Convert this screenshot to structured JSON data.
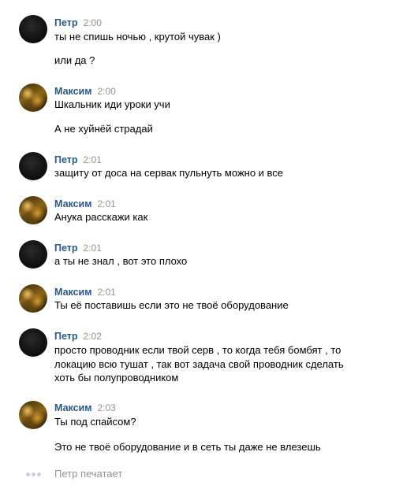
{
  "typing_indicator": "Петр печатает",
  "messages": [
    {
      "author": "Петр",
      "time": "2:00",
      "lines": [
        "ты не спишь ночью , крутой чувак )",
        "или да ?"
      ]
    },
    {
      "author": "Максим",
      "time": "2:00",
      "lines": [
        "Шкальник иди уроки учи",
        "А не хуйнёй страдай"
      ]
    },
    {
      "author": "Петр",
      "time": "2:01",
      "lines": [
        "защиту от доса на сервак пульнуть можно и все"
      ]
    },
    {
      "author": "Максим",
      "time": "2:01",
      "lines": [
        "Анука расскажи как"
      ]
    },
    {
      "author": "Петр",
      "time": "2:01",
      "lines": [
        "а ты не знал , вот это плохо"
      ]
    },
    {
      "author": "Максим",
      "time": "2:01",
      "lines": [
        "Ты её поставишь если это не твоё оборудование"
      ]
    },
    {
      "author": "Петр",
      "time": "2:02",
      "lines": [
        "просто проводник если твой серв , то когда тебя бомбят , то",
        "локацию всю тушат , так вот задача свой проводник сделать",
        "хоть бы полупроводником"
      ]
    },
    {
      "author": "Максим",
      "time": "2:03",
      "lines": [
        "Ты под спайсом?",
        "Это не твоё оборудование и в сеть ты даже не влезешь"
      ]
    }
  ]
}
